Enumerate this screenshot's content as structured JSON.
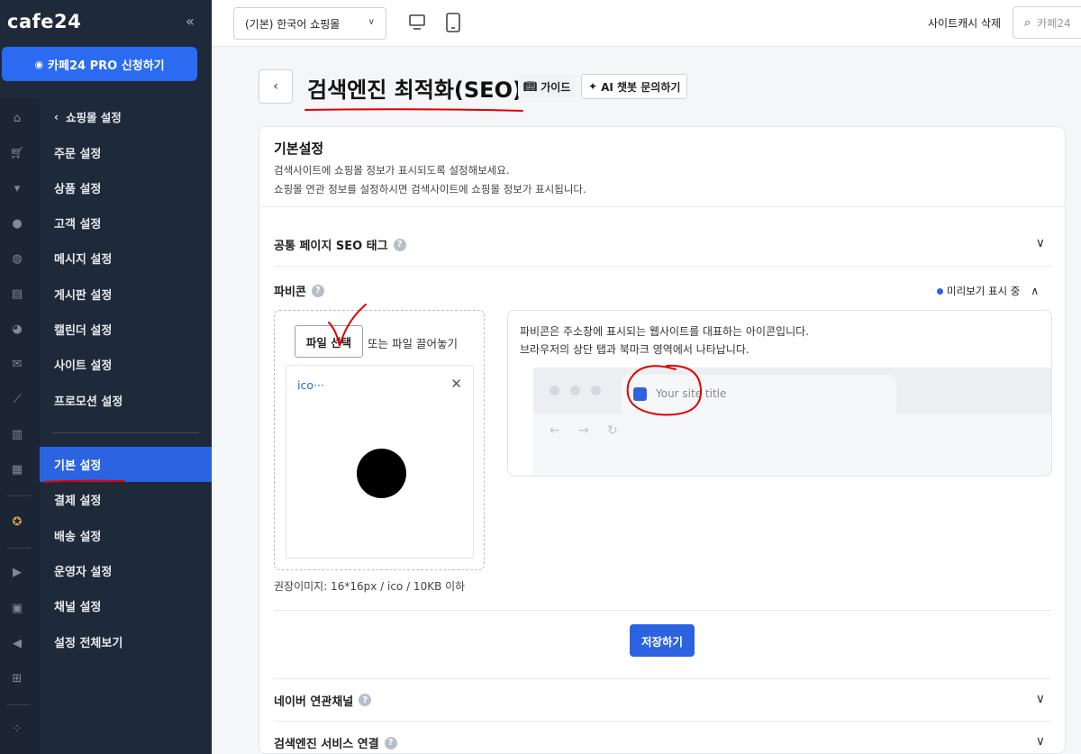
{
  "sidebar": {
    "logo": "cafe24",
    "collapse_icon": "«",
    "pro_button": "카페24 PRO 신청하기",
    "back_label": "쇼핑몰 설정",
    "items": [
      {
        "label": "주문 설정"
      },
      {
        "label": "상품 설정"
      },
      {
        "label": "고객 설정"
      },
      {
        "label": "메시지 설정"
      },
      {
        "label": "게시판 설정"
      },
      {
        "label": "캘린더 설정"
      },
      {
        "label": "사이트 설정"
      },
      {
        "label": "프로모션 설정"
      },
      {
        "label": "기본 설정",
        "active": true
      },
      {
        "label": "결제 설정"
      },
      {
        "label": "배송 설정"
      },
      {
        "label": "운영자 설정"
      },
      {
        "label": "채널 설정"
      },
      {
        "label": "설정 전체보기"
      }
    ],
    "rail_icons": [
      "home-icon",
      "cart-icon",
      "shirt-icon",
      "user-icon",
      "chat-icon",
      "board-icon",
      "palette-icon",
      "mail-icon",
      "chart-icon",
      "stats-icon",
      "excel-icon",
      "badge-icon",
      "youtube-icon",
      "shop-icon",
      "megaphone-icon",
      "store-icon",
      "apps-icon"
    ]
  },
  "topbar": {
    "mall_select": "(기본) 한국어 쇼핑몰",
    "cache_button": "사이트캐시 삭제",
    "search_placeholder": "카페24"
  },
  "page": {
    "title": "검색엔진 최적화(SEO)",
    "guide_button": "가이드",
    "ai_button": "AI 챗봇 문의하기"
  },
  "card": {
    "title": "기본설정",
    "desc_line1": "검색사이트에 쇼핑몰 정보가 표시되도록 설정해보세요.",
    "desc_line2": "쇼핑몰 연관 정보를 설정하시면 검색사이트에 쇼핑몰 정보가 표시됩니다.",
    "common_seo": "공통 페이지 SEO 태그",
    "favicon_title": "파비콘",
    "preview_status": "미리보기 표시 중",
    "file_button": "파일 선택",
    "drag_text": "또는 파일 끌어놓기",
    "file_name": "ico···",
    "recommend": "권장이미지: 16*16px / ico / 10KB 이하",
    "preview_desc1": "파비콘은 주소창에 표시되는 웹사이트를 대표하는 아이콘입니다.",
    "preview_desc2": "브라우저의 상단 탭과 북마크 영역에서 나타납니다.",
    "tab_title": "Your site title",
    "save_button": "저장하기",
    "naver_channel": "네이버 연관채널",
    "search_engine": "검색엔진 서비스 연결"
  },
  "colors": {
    "sidebar_bg": "#1e2a3a",
    "accent": "#2b63e0",
    "annotation": "#e00000"
  }
}
